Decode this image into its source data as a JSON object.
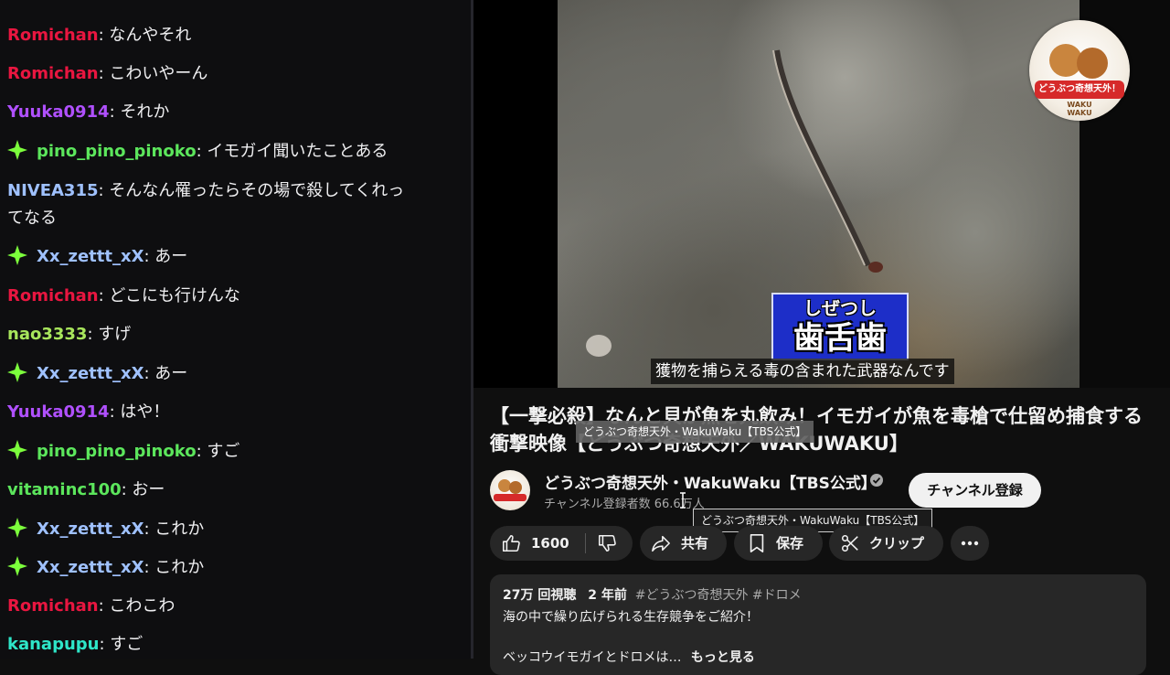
{
  "chat": {
    "messages": [
      {
        "user": "Romichan",
        "text": ": なんやそれ",
        "color": "#e91640",
        "badge": false
      },
      {
        "user": "Romichan",
        "text": ": こわいやーん",
        "color": "#e91640",
        "badge": false
      },
      {
        "user": "Yuuka0914",
        "text": ": それか",
        "color": "#b050ff",
        "badge": false
      },
      {
        "user": "pino_pino_pinoko",
        "text": ": イモガイ聞いたことある",
        "color": "#5ce65c",
        "badge": true
      },
      {
        "user": "NIVEA315",
        "text": ": そんなん罹ったらその場で殺してくれっ",
        "text2": "てなる",
        "color": "#9fc1ff",
        "badge": false
      },
      {
        "user": "Xx_zettt_xX",
        "text": ": あー",
        "color": "#9fc1ff",
        "badge": true
      },
      {
        "user": "Romichan",
        "text": ": どこにも行けんな",
        "color": "#e91640",
        "badge": false
      },
      {
        "user": "nao3333",
        "text": ": すげ",
        "color": "#a8e65c",
        "badge": false
      },
      {
        "user": "Xx_zettt_xX",
        "text": ": あー",
        "color": "#9fc1ff",
        "badge": true
      },
      {
        "user": "Yuuka0914",
        "text": ": はや！",
        "color": "#b050ff",
        "badge": false
      },
      {
        "user": "pino_pino_pinoko",
        "text": ": すご",
        "color": "#5ce65c",
        "badge": true
      },
      {
        "user": "vitaminc100",
        "text": ": おー",
        "color": "#5ce65c",
        "badge": false
      },
      {
        "user": "Xx_zettt_xX",
        "text": ": これか",
        "color": "#9fc1ff",
        "badge": true
      },
      {
        "user": "Xx_zettt_xX",
        "text": ": これか",
        "color": "#9fc1ff",
        "badge": true
      },
      {
        "user": "Romichan",
        "text": ": こわこわ",
        "color": "#e91640",
        "badge": false
      },
      {
        "user": "kanapupu",
        "text": ": すご",
        "color": "#2ee6c8",
        "badge": false
      }
    ]
  },
  "video": {
    "caption_ruby": "しぜつし",
    "caption_main": "歯舌歯",
    "subtitle": "獲物を捕らえる毒の含まれた武器なんです",
    "logo_text": "どうぶつ奇想天外！",
    "logo_subtext": "WAKU WAKU"
  },
  "meta": {
    "title": "【一撃必殺】なんと貝が魚を丸飲み！イモガイが魚を毒槍で仕留め捕食する衝撃映像【どうぶつ奇想天外／WAKUWAKU】",
    "channel_name": "どうぶつ奇想天外・WakuWaku【TBS公式】",
    "subscribers": "チャンネル登録者数 66.6万人",
    "subscribe_label": "チャンネル登録",
    "tooltip_channel": "どうぶつ奇想天外・WakuWaku【TBS公式】",
    "tooltip_channel2": "どうぶつ奇想天外・WakuWaku【TBS公式】"
  },
  "actions": {
    "like_count": "1600",
    "share_label": "共有",
    "save_label": "保存",
    "clip_label": "クリップ"
  },
  "description": {
    "views": "27万 回視聴",
    "age": "2 年前",
    "tags": "#どうぶつ奇想天外 #ドロメ",
    "line1": "海の中で繰り広げられる生存競争をご紹介！",
    "line2": "ベッコウイモガイとドロメは…",
    "more_label": "もっと見る"
  },
  "colors": {
    "background": "#0f0f0f",
    "chat_background": "#0e0e10",
    "pill_background": "#272727",
    "caption_box": "#1d2ec8",
    "badge_green": "#7cff3c"
  }
}
